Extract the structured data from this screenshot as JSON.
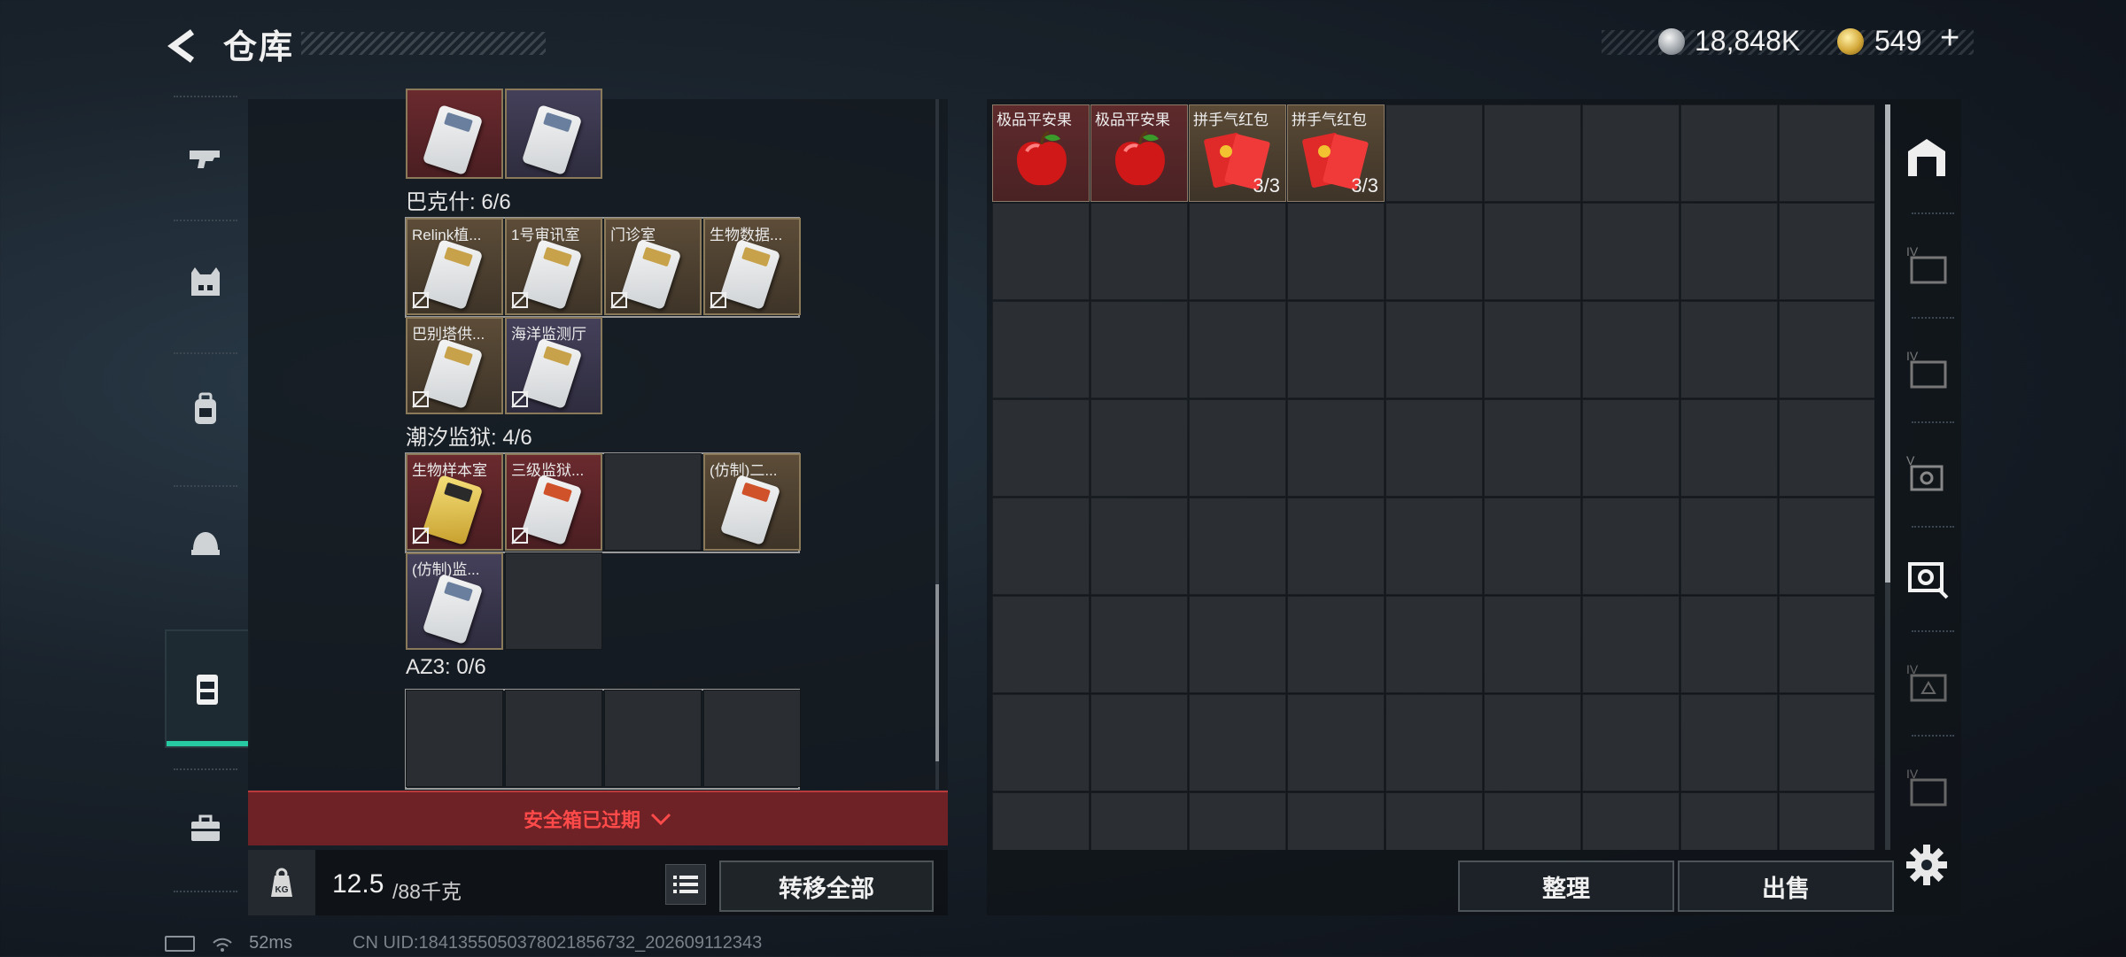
{
  "header": {
    "title": "仓库",
    "silver": "18,848K",
    "gold": "549",
    "gold_plus": "+"
  },
  "left_panel": {
    "group_labels": [
      "巴克什: 6/6",
      "潮汐监狱: 4/6",
      "AZ3: 0/6"
    ],
    "bakeshi_items": [
      "Relink植...",
      "1号审讯室",
      "门诊室",
      "生物数据...",
      "巴别塔供...",
      "海洋监测厅"
    ],
    "tide_items": [
      "生物样本室",
      "三级监狱...",
      "",
      "(仿制)二...",
      "(仿制)监..."
    ],
    "safe_box_expired": "安全箱已过期",
    "weight_current": "12.5",
    "weight_max": "/88千克",
    "weight_unit_icon": "KG",
    "transfer_all": "转移全部"
  },
  "right_panel": {
    "items": [
      {
        "name": "极品平安果",
        "count": ""
      },
      {
        "name": "极品平安果",
        "count": ""
      },
      {
        "name": "拼手气红包",
        "count": "3/3"
      },
      {
        "name": "拼手气红包",
        "count": "3/3"
      }
    ],
    "sort": "整理",
    "sell": "出售",
    "tab_roman": [
      "IV",
      "IV",
      "V",
      "IV",
      "IV"
    ]
  },
  "status": {
    "ping": "52ms",
    "uid": "CN UID:1841355050378021856732_202609112343"
  },
  "colors": {
    "accent": "#27c9a2",
    "warning": "#ff4a4a"
  }
}
